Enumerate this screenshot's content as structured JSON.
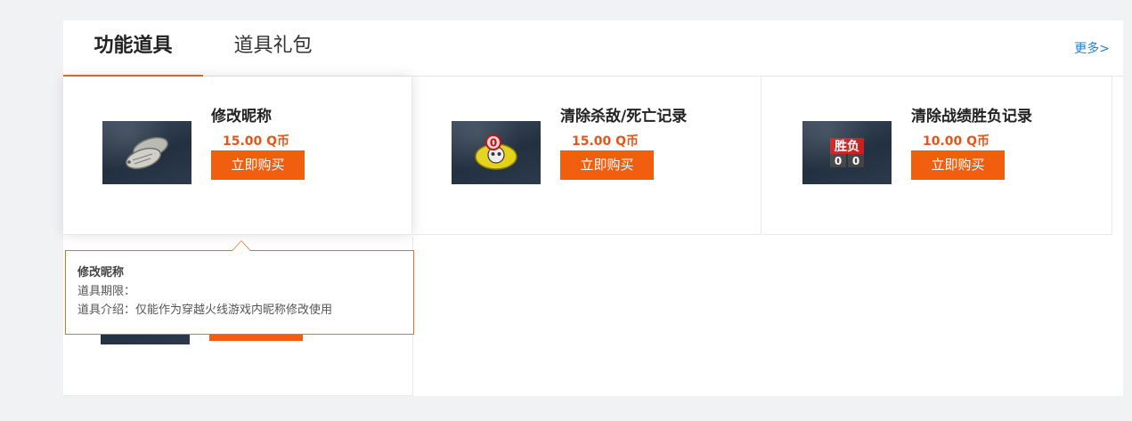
{
  "tabs": [
    {
      "label": "功能道具",
      "active": true
    },
    {
      "label": "道具礼包",
      "active": false
    }
  ],
  "more_label": "更多>",
  "products": [
    {
      "title": "修改昵称",
      "price": "15.00 Q币",
      "buy_label": "立即购买",
      "icon": "dog-tag-icon"
    },
    {
      "title": "清除杀敌/死亡记录",
      "price": "15.00 Q币",
      "buy_label": "立即购买",
      "icon": "reset-kd-icon"
    },
    {
      "title": "清除战绩胜负记录",
      "price": "10.00 Q币",
      "buy_label": "立即购买",
      "icon": "win-loss-icon"
    }
  ],
  "win_loss_icon": {
    "top": "胜负",
    "left_digit": "0",
    "right_digit": "0"
  },
  "kd_icon_digit": "0",
  "tooltip": {
    "title": "修改昵称",
    "period_label": "道具期限：",
    "intro_label": "道具介绍：",
    "intro_text": "仅能作为穿越火线游戏内昵称修改使用"
  },
  "colors": {
    "accent": "#f15f0e",
    "price": "#e8551a",
    "link": "#2a7fc7"
  }
}
